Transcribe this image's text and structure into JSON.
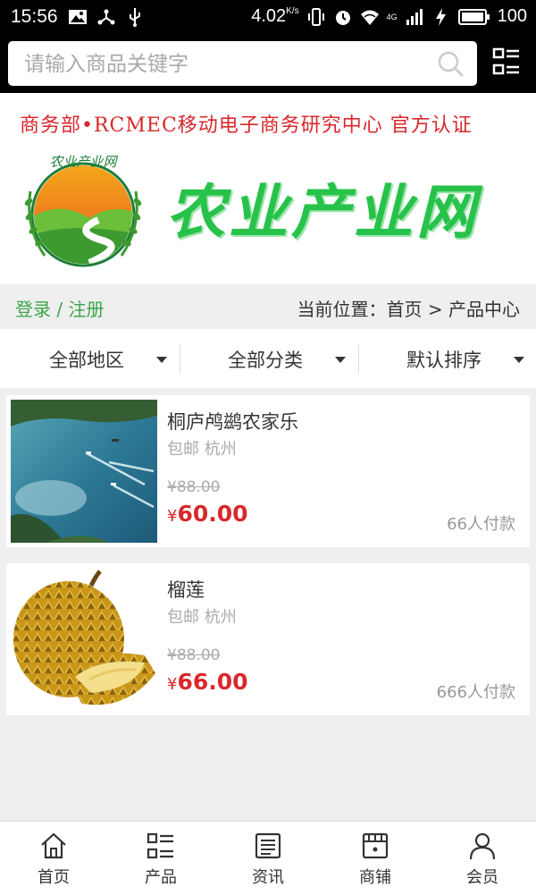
{
  "status_bar": {
    "time": "15:56",
    "speed": "4.02",
    "speed_unit": "K/s",
    "network": "4G",
    "battery": "100",
    "icons": [
      "image-icon",
      "usb-debug-icon",
      "usb-icon",
      "vibrate-icon",
      "alarm-icon",
      "wifi-icon",
      "signal-icon",
      "charging-icon",
      "battery-icon"
    ]
  },
  "search": {
    "placeholder": "请输入商品关键字",
    "search_icon": "search-icon",
    "menu_icon": "category-menu-icon"
  },
  "banner": {
    "tagline": "商务部•RCMEC移动电子商务研究中心 官方认证",
    "logo_text": "农业产业网",
    "site_title": "农业产业网"
  },
  "breadcrumb_bar": {
    "login": "登录",
    "separator": "/",
    "register": "注册",
    "location_label": "当前位置：",
    "home": "首页",
    "arrow": ">",
    "current": "产品中心"
  },
  "filters": [
    {
      "label": "全部地区"
    },
    {
      "label": "全部分类"
    },
    {
      "label": "默认排序"
    }
  ],
  "products": [
    {
      "name": "桐庐鸬鹚农家乐",
      "shipping": "包邮",
      "city": "杭州",
      "old_price": "¥88.00",
      "currency": "¥",
      "price": "60.00",
      "sold": "66人付款",
      "image": "lake-with-boats"
    },
    {
      "name": "榴莲",
      "shipping": "包邮",
      "city": "杭州",
      "old_price": "¥88.00",
      "currency": "¥",
      "price": "66.00",
      "sold": "666人付款",
      "image": "durian"
    }
  ],
  "tabs": [
    {
      "label": "首页",
      "icon": "home-icon"
    },
    {
      "label": "产品",
      "icon": "product-list-icon"
    },
    {
      "label": "资讯",
      "icon": "news-icon"
    },
    {
      "label": "商铺",
      "icon": "shop-icon"
    },
    {
      "label": "会员",
      "icon": "member-icon"
    }
  ],
  "colors": {
    "accent_green": "#27c24a",
    "price_red": "#d8282c",
    "login_green": "#3aa64a"
  }
}
